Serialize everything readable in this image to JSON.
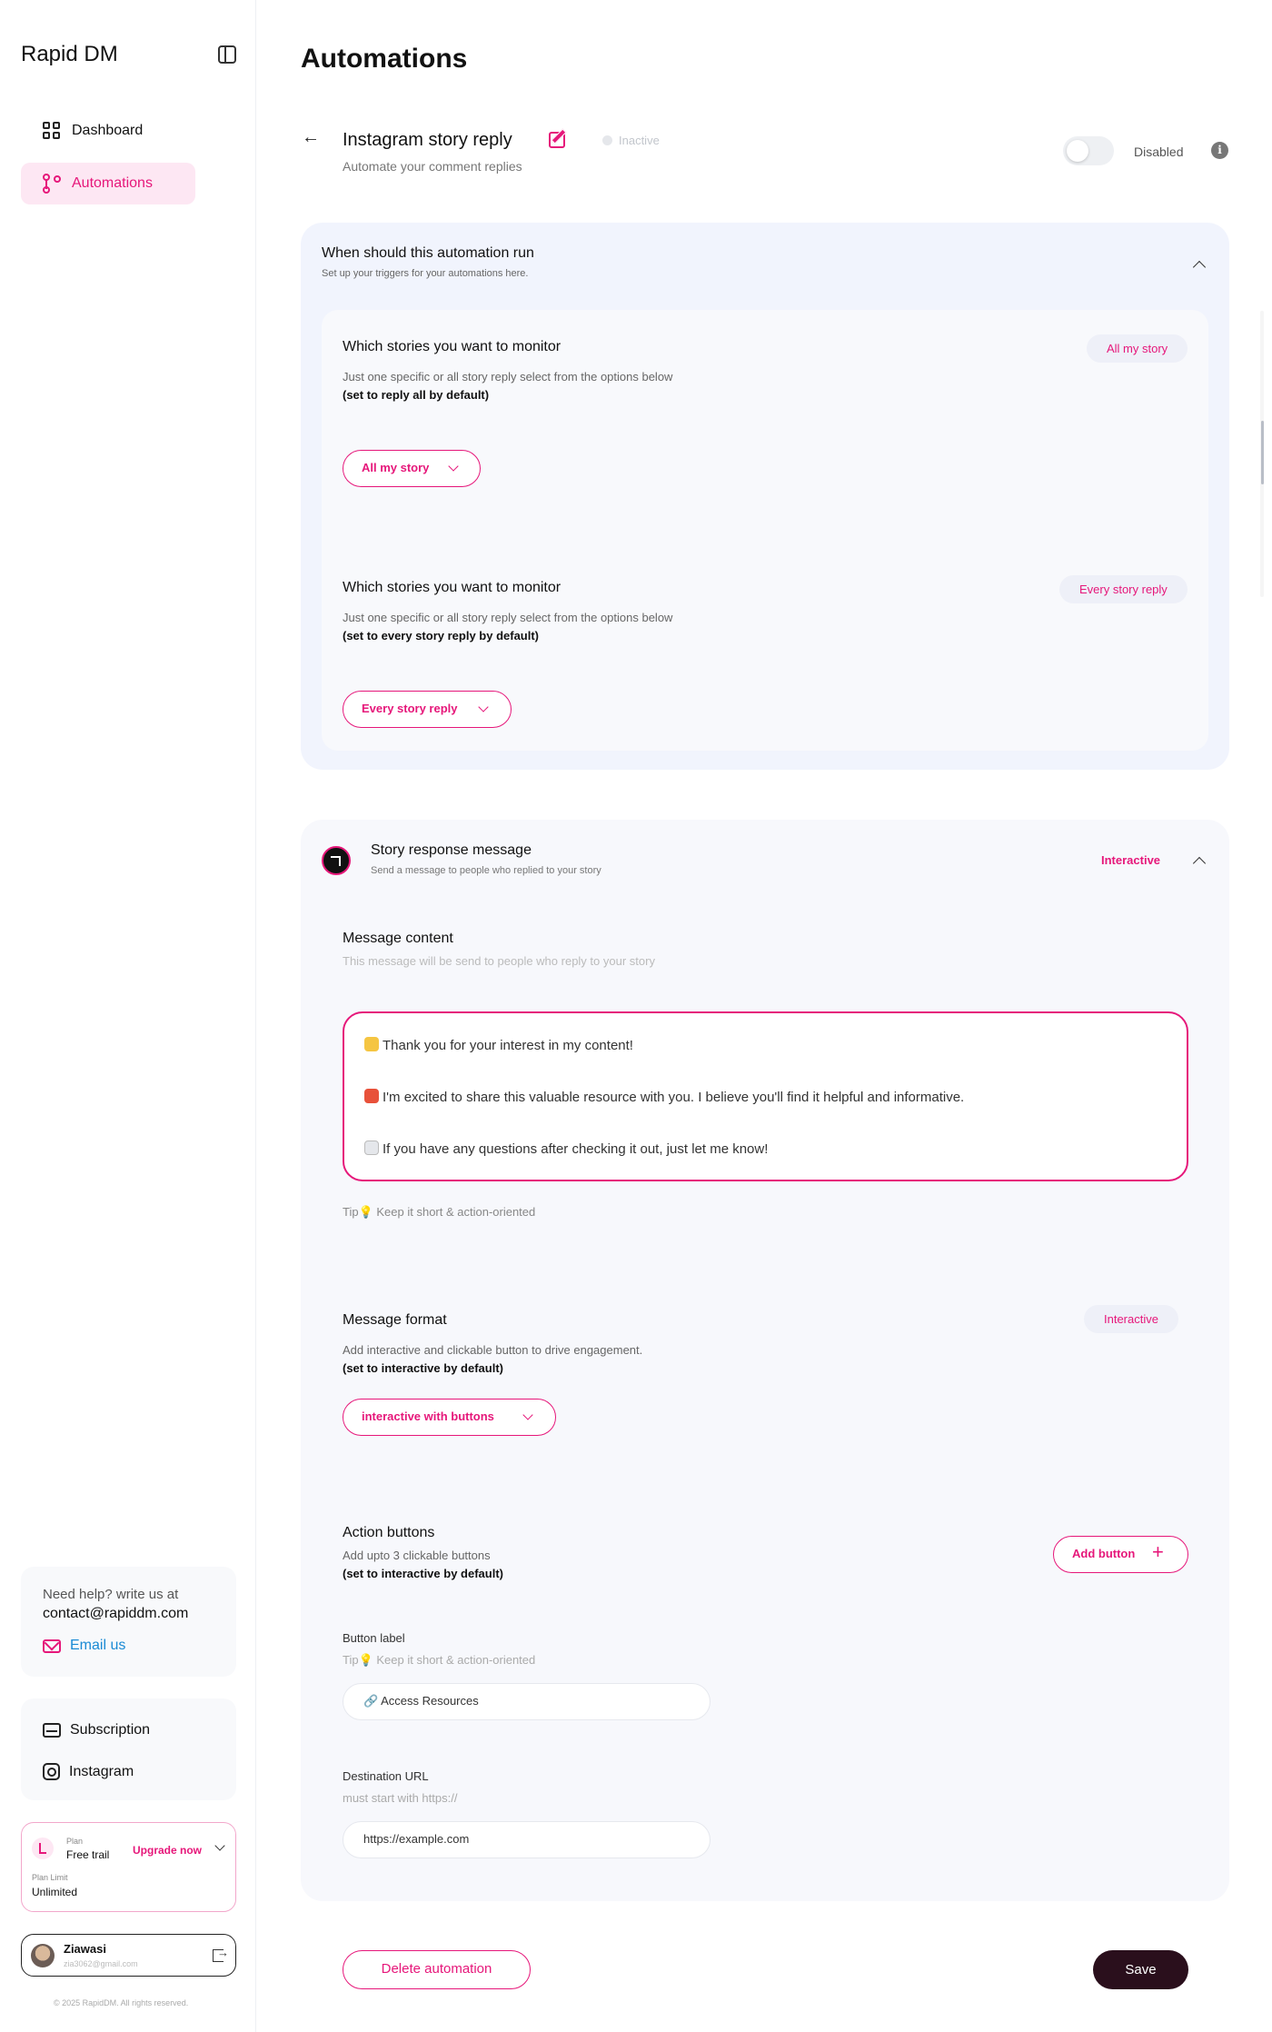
{
  "sidebar": {
    "brand": "Rapid DM",
    "nav": [
      {
        "label": "Dashboard",
        "icon": "dashboard-grid-icon"
      },
      {
        "label": "Automations",
        "icon": "automation-flow-icon",
        "active": true
      }
    ],
    "help": {
      "line1": "Need help? write us at",
      "email_address": "contact@rapiddm.com",
      "email_link": "Email us"
    },
    "links": [
      {
        "label": "Subscription",
        "icon": "credit-card-icon"
      },
      {
        "label": "Instagram",
        "icon": "instagram-icon"
      }
    ],
    "plan": {
      "plan_label": "Plan",
      "plan_value": "Free trail",
      "upgrade_label": "Upgrade now",
      "limit_label": "Plan Limit",
      "limit_value": "Unlimited"
    },
    "user": {
      "name": "Ziawasi",
      "email": "zia3062@gmail.com"
    },
    "copyright": "© 2025 RapidDM. All rights reserved."
  },
  "main": {
    "page_title": "Automations",
    "automation": {
      "name": "Instagram story reply",
      "subtitle": "Automate your comment replies",
      "status": "Inactive",
      "toggle_label": "Disabled",
      "toggle_on": false
    },
    "trigger_panel": {
      "title": "When should this automation run",
      "subtitle": "Set up your triggers for your automations here.",
      "sections": [
        {
          "title": "Which stories you want to monitor",
          "description": "Just one specific or all story reply select from the options below",
          "default_note": "(set to reply all by default)",
          "chip": "All my story",
          "select_value": "All my story"
        },
        {
          "title": "Which stories you want to monitor",
          "description": "Just one specific or all story reply select from the options below",
          "default_note": "(set to every story reply by default)",
          "chip": "Every story reply",
          "select_value": "Every story reply"
        }
      ]
    },
    "response_panel": {
      "title": "Story response message",
      "subtitle": "Send a message to people who replied to your story",
      "badge": "Interactive",
      "message_content": {
        "title": "Message content",
        "hint": "This message will be send to people who reply to your story",
        "lines": [
          "Thank you for your interest in my content!",
          "I'm excited to share this valuable resource with you. I believe you'll find it helpful and informative.",
          "If you have any questions after checking it out, just let me know!"
        ],
        "tip": "Tip💡 Keep it short & action-oriented"
      },
      "message_format": {
        "title": "Message format",
        "description": "Add interactive and clickable button to drive engagement.",
        "default_note": "(set to interactive by default)",
        "chip": "Interactive",
        "select_value": "interactive with buttons"
      },
      "action_buttons": {
        "title": "Action buttons",
        "description": "Add upto 3 clickable buttons",
        "default_note": "(set to interactive by default)",
        "add_label": "Add button",
        "button_label_title": "Button label",
        "button_label_tip": "Tip💡 Keep it short & action-oriented",
        "button_label_value": "🔗 Access Resources",
        "url_title": "Destination URL",
        "url_hint": "must start with https://",
        "url_placeholder": "https://example.com"
      }
    },
    "footer": {
      "delete_label": "Delete automation",
      "save_label": "Save"
    }
  },
  "colors": {
    "accent": "#e6177a",
    "panel_bg": "#f1f4fd",
    "save_bg": "#2a0f1c"
  }
}
